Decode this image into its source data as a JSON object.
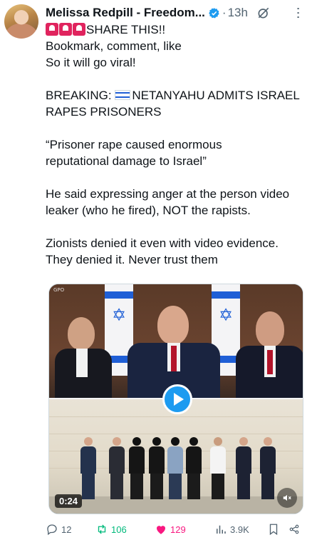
{
  "post": {
    "author_name": "Melissa Redpill - Freedom...",
    "timestamp": "13h",
    "dot": "·",
    "lines": [
      "SHARE THIS!!",
      "Bookmark, comment, like",
      "So it will go viral!",
      "",
      "BREAKING:",
      "NETANYAHU ADMITS ISRAEL",
      "RAPES PRISONERS",
      "",
      "“Prisoner rape caused enormous",
      "reputational damage to Israel”",
      "",
      "He said expressing anger at the person video",
      "leaker (who he fired), NOT the rapists.",
      "",
      "Zionists denied it even with video evidence.",
      "They denied it. Never trust them"
    ]
  },
  "media": {
    "watermark": "GPO",
    "duration": "0:24"
  },
  "actions": {
    "replies": "12",
    "reposts": "106",
    "likes": "129",
    "views": "3.9K"
  },
  "colors": {
    "accent": "#1d9bf0",
    "repost": "#00ba7c",
    "like": "#f91880",
    "muted": "#536471"
  },
  "icons": [
    "verified-badge-icon",
    "grok-icon",
    "more-icon",
    "siren-emoji",
    "israel-flag-emoji",
    "play-icon",
    "volume-icon",
    "reply-icon",
    "repost-icon",
    "like-icon",
    "views-icon",
    "bookmark-icon",
    "share-icon"
  ]
}
